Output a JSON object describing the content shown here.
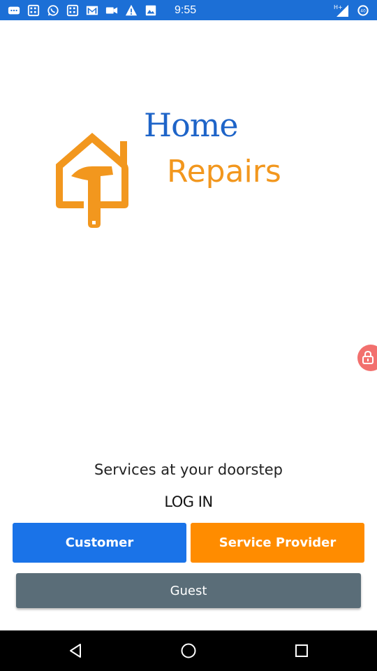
{
  "status_bar": {
    "time": "9:55",
    "left_icons": [
      "chat-icon",
      "calculator-icon",
      "whatsapp-icon",
      "calculator-icon",
      "gmail-icon",
      "video-icon",
      "warning-icon",
      "image-icon"
    ],
    "right_icons": [
      "signal-icon",
      "battery-icon"
    ],
    "network_label": "H+",
    "battery_level": "40",
    "color": "#1c6fd6"
  },
  "brand": {
    "line1": "Home",
    "line2": "Repairs",
    "line1_color": "#1e64c8",
    "line2_color": "#f2971e",
    "logo_icon": "house-hammer-icon"
  },
  "main": {
    "tagline": "Services at your doorstep",
    "login_label": "LOG IN"
  },
  "buttons": {
    "customer": "Customer",
    "service_provider": "Service Provider",
    "guest": "Guest",
    "customer_color": "#1a73e8",
    "provider_color": "#ff8c00",
    "guest_color": "#5a6d78"
  },
  "nav_bar": {
    "icons": [
      "back-icon",
      "home-icon",
      "recents-icon"
    ]
  }
}
